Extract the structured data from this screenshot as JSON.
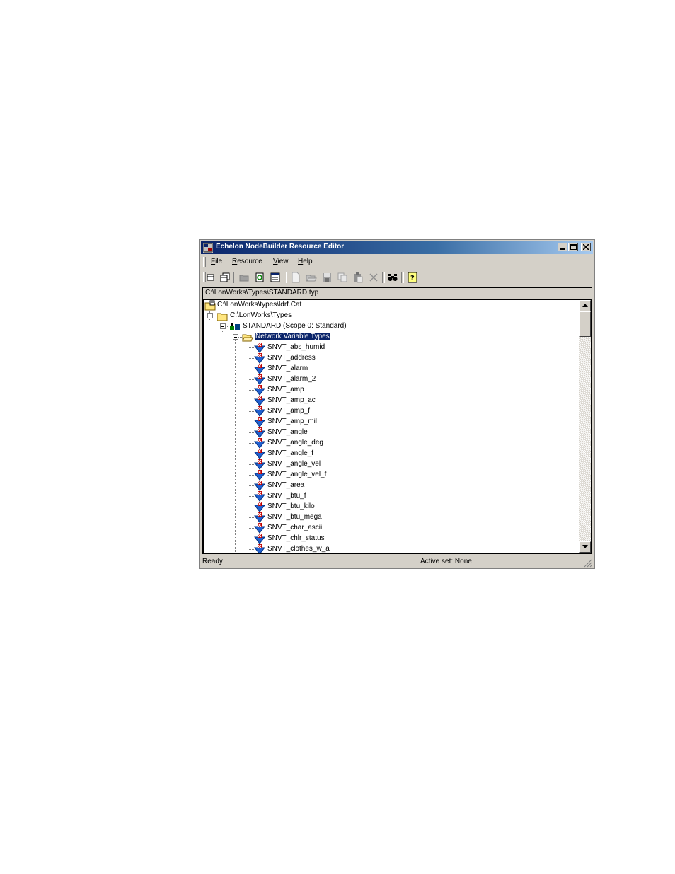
{
  "window": {
    "title": "Echelon NodeBuilder Resource Editor",
    "title_bar_color": "#0a246a",
    "selection_color": "#0a246a"
  },
  "menu": [
    "File",
    "Resource",
    "View",
    "Help"
  ],
  "toolbar_icons": [
    "new-icon",
    "new-window-icon",
    "folder-icon",
    "refresh-icon",
    "properties-icon",
    "new-file-icon",
    "open-icon",
    "save-icon",
    "copy-icon",
    "paste-icon",
    "delete-icon",
    "find-icon",
    "help-icon"
  ],
  "path": "C:\\LonWorks\\Types\\STANDARD.typ",
  "tree": {
    "catalog": "C:\\LonWorks\\types\\ldrf.Cat",
    "folder": "C:\\LonWorks\\Types",
    "scope": "STANDARD (Scope 0: Standard)",
    "category": "Network Variable Types",
    "items": [
      "SNVT_abs_humid",
      "SNVT_address",
      "SNVT_alarm",
      "SNVT_alarm_2",
      "SNVT_amp",
      "SNVT_amp_ac",
      "SNVT_amp_f",
      "SNVT_amp_mil",
      "SNVT_angle",
      "SNVT_angle_deg",
      "SNVT_angle_f",
      "SNVT_angle_vel",
      "SNVT_angle_vel_f",
      "SNVT_area",
      "SNVT_btu_f",
      "SNVT_btu_kilo",
      "SNVT_btu_mega",
      "SNVT_char_ascii",
      "SNVT_chlr_status",
      "SNVT_clothes_w_a"
    ]
  },
  "status": {
    "left": "Ready",
    "right": "Active set: None"
  }
}
